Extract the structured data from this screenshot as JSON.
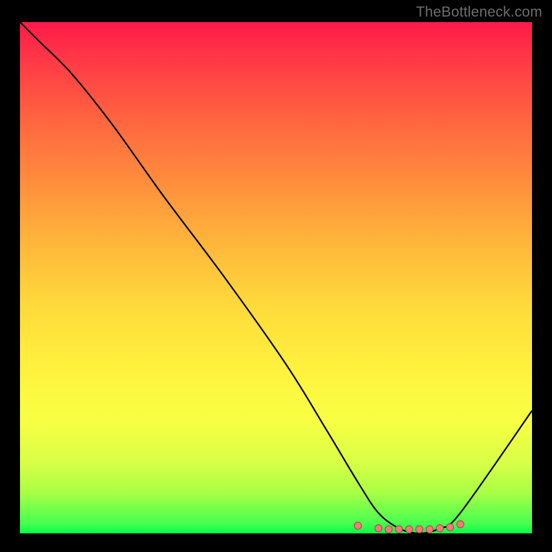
{
  "attribution": "TheBottleneck.com",
  "colors": {
    "background": "#000000",
    "attribution_text": "#6d6d6d",
    "curve_stroke": "#000000",
    "marker_fill": "#ef7b7d",
    "marker_stroke": "#bb3a3c",
    "gradient_top": "#ff1a49",
    "gradient_mid": "#fff23e",
    "gradient_bottom": "#06ff4a"
  },
  "chart_data": {
    "type": "line",
    "title": "",
    "xlabel": "",
    "ylabel": "",
    "xlim": [
      0,
      100
    ],
    "ylim": [
      0,
      100
    ],
    "x": [
      0,
      4,
      10,
      18,
      28,
      40,
      52,
      60,
      66,
      70,
      74,
      78,
      82,
      86,
      100
    ],
    "values": [
      100,
      96,
      90,
      80,
      66,
      50,
      33,
      20,
      10,
      4,
      1,
      0,
      1,
      4,
      24
    ],
    "markers": {
      "x": [
        66,
        70,
        72,
        74,
        76,
        78,
        80,
        82,
        84,
        86
      ],
      "y": [
        1.5,
        1,
        0.8,
        0.8,
        0.8,
        0.8,
        0.8,
        1,
        1.2,
        1.8
      ]
    }
  }
}
